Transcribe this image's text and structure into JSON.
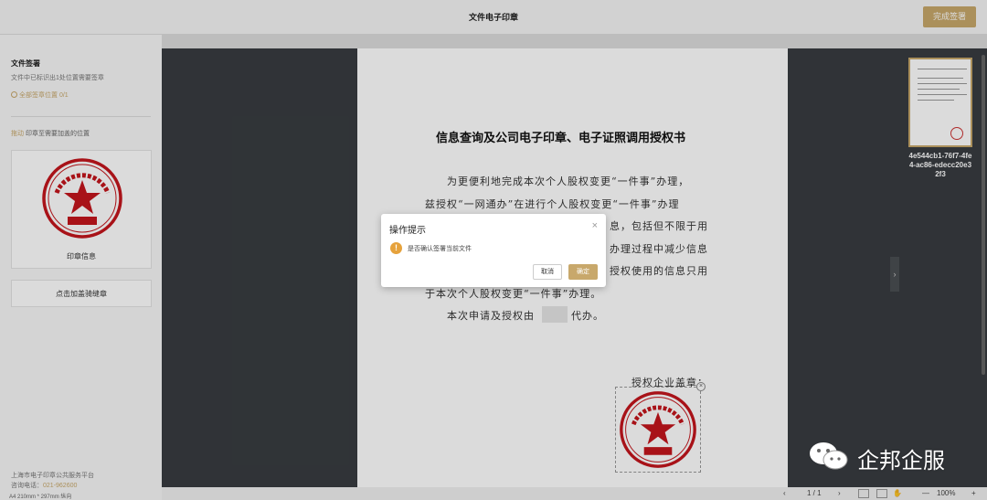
{
  "app": {
    "title": "文件电子印章",
    "finish_button": "完成签署"
  },
  "sidebar": {
    "section_title": "文件签署",
    "subtitle": "文件中已标识出1处位置需要签章",
    "all_positions_link": "全部签章位置 0/1",
    "drag_hint_highlight": "拖动",
    "drag_hint_rest": " 印章至需要加盖的位置",
    "seal_card_label": "印章信息",
    "riding_seal_button": "点击加盖骑缝章",
    "platform_name": "上海市电子印章公共服务平台",
    "hotline_label": "咨询电话：",
    "hotline_number": "021-962600",
    "page_size": "A4 210mm * 297mm 纵向"
  },
  "seal": {
    "org_text": "上海CA技术支持中心",
    "center_text": "测试章",
    "color": "#c4161c"
  },
  "document": {
    "title": "信息查询及公司电子印章、电子证照调用授权书",
    "line1": "为更便利地完成本次个人股权变更“一件事”办理，",
    "line2": "兹授权“一网通办”在进行个人股权变更“一件事”办理",
    "frag_a": "息，包括但不限于用",
    "frag_b": "办理过程中减少信息",
    "frag_c": "授权使用的信息只用",
    "line6": "于本次个人股权变更“一件事”办理。",
    "line7_a": "本次申请及授权由",
    "line7_b": "代办。",
    "sign_label": "授权企业盖章："
  },
  "thumbnail": {
    "file_id": "4e544cb1-76f7-4fe4-ac86-edecc20e32f3"
  },
  "bottombar": {
    "page_indicator": "1 / 1",
    "zoom": "100%",
    "zoom_out": "—",
    "zoom_in": "+"
  },
  "dialog": {
    "title": "操作提示",
    "message": "是否确认签署当前文件",
    "cancel_label": "取消",
    "confirm_label": "确定",
    "close_symbol": "×",
    "warn_symbol": "!"
  },
  "watermark": {
    "text": "企邦企服"
  },
  "colors": {
    "accent": "#c8a86b",
    "dark_bg": "#383c40",
    "warning": "#e6a23c"
  }
}
